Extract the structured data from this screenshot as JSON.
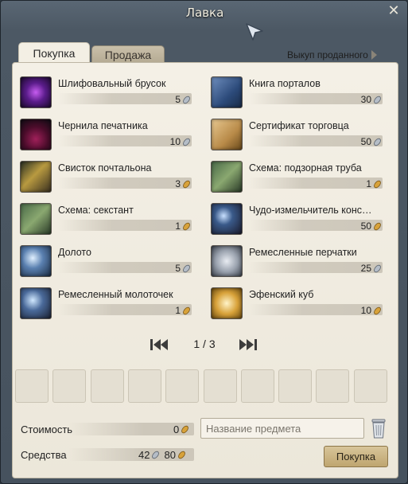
{
  "window": {
    "title": "Лавка"
  },
  "tabs": [
    {
      "label": "Покупка",
      "active": true
    },
    {
      "label": "Продажа",
      "active": false
    }
  ],
  "buyback": {
    "label": "Выкуп проданного"
  },
  "items": [
    {
      "name": "Шлифовальный брусок",
      "price": "5",
      "currency": "silver",
      "icon": "whetstone-icon"
    },
    {
      "name": "Книга порталов",
      "price": "30",
      "currency": "silver",
      "icon": "portal-book-icon"
    },
    {
      "name": "Чернила печатника",
      "price": "10",
      "currency": "silver",
      "icon": "ink-bottle-icon"
    },
    {
      "name": "Сертификат торговца",
      "price": "50",
      "currency": "silver",
      "icon": "certificate-icon"
    },
    {
      "name": "Свисток почтальона",
      "price": "3",
      "currency": "gold",
      "icon": "whistle-icon"
    },
    {
      "name": "Схема: подзорная труба",
      "price": "1",
      "currency": "gold",
      "icon": "blueprint-icon"
    },
    {
      "name": "Схема: секстант",
      "price": "1",
      "currency": "gold",
      "icon": "blueprint-icon"
    },
    {
      "name": "Чудо-измельчитель конс…",
      "price": "50",
      "currency": "gold",
      "icon": "grinder-icon"
    },
    {
      "name": "Долото",
      "price": "5",
      "currency": "silver",
      "icon": "chisel-icon"
    },
    {
      "name": "Ремесленные перчатки",
      "price": "25",
      "currency": "silver",
      "icon": "gloves-icon"
    },
    {
      "name": "Ремесленный молоточек",
      "price": "1",
      "currency": "gold",
      "icon": "hammer-icon"
    },
    {
      "name": "Эфенский куб",
      "price": "10",
      "currency": "gold",
      "icon": "cube-icon"
    }
  ],
  "pager": {
    "text": "1 / 3"
  },
  "cart": {
    "slot_count": 10
  },
  "footer": {
    "cost_label": "Стоимость",
    "cost_value": "0",
    "funds_label": "Средства",
    "funds_silver": "42",
    "funds_gold": "80",
    "search_placeholder": "Название предмета",
    "buy_label": "Покупка"
  },
  "colors": {
    "silver": "#8a94a0",
    "gold": "#c8962e",
    "accent": "#bfa56f"
  }
}
